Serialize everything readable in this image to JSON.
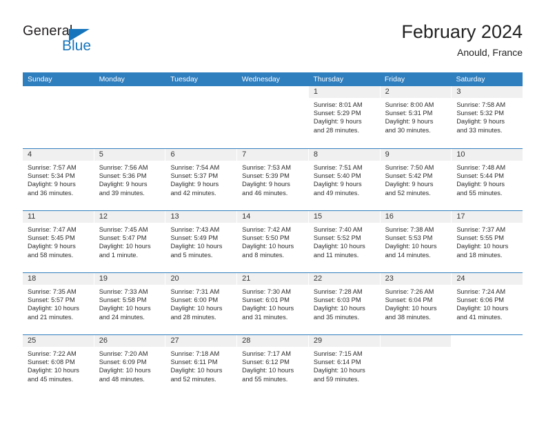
{
  "brand": {
    "name_top": "General",
    "name_bottom": "Blue",
    "accent_color": "#1574bb"
  },
  "header": {
    "title": "February 2024",
    "subtitle": "Anould, France"
  },
  "calendar": {
    "header_bg": "#2f7ebe",
    "header_text_color": "#ffffff",
    "daynum_bg": "#f0f0f0",
    "weekdays": [
      "Sunday",
      "Monday",
      "Tuesday",
      "Wednesday",
      "Thursday",
      "Friday",
      "Saturday"
    ],
    "labels": {
      "sunrise": "Sunrise:",
      "sunset": "Sunset:",
      "daylight": "Daylight:"
    },
    "weeks": [
      [
        {
          "day": "",
          "sunrise": "",
          "sunset": "",
          "daylight_line1": "",
          "daylight_line2": "",
          "filled": false
        },
        {
          "day": "",
          "sunrise": "",
          "sunset": "",
          "daylight_line1": "",
          "daylight_line2": "",
          "filled": false
        },
        {
          "day": "",
          "sunrise": "",
          "sunset": "",
          "daylight_line1": "",
          "daylight_line2": "",
          "filled": false
        },
        {
          "day": "",
          "sunrise": "",
          "sunset": "",
          "daylight_line1": "",
          "daylight_line2": "",
          "filled": false
        },
        {
          "day": "1",
          "sunrise": "Sunrise: 8:01 AM",
          "sunset": "Sunset: 5:29 PM",
          "daylight_line1": "Daylight: 9 hours",
          "daylight_line2": "and 28 minutes.",
          "filled": true
        },
        {
          "day": "2",
          "sunrise": "Sunrise: 8:00 AM",
          "sunset": "Sunset: 5:31 PM",
          "daylight_line1": "Daylight: 9 hours",
          "daylight_line2": "and 30 minutes.",
          "filled": true
        },
        {
          "day": "3",
          "sunrise": "Sunrise: 7:58 AM",
          "sunset": "Sunset: 5:32 PM",
          "daylight_line1": "Daylight: 9 hours",
          "daylight_line2": "and 33 minutes.",
          "filled": true
        }
      ],
      [
        {
          "day": "4",
          "sunrise": "Sunrise: 7:57 AM",
          "sunset": "Sunset: 5:34 PM",
          "daylight_line1": "Daylight: 9 hours",
          "daylight_line2": "and 36 minutes.",
          "filled": true
        },
        {
          "day": "5",
          "sunrise": "Sunrise: 7:56 AM",
          "sunset": "Sunset: 5:36 PM",
          "daylight_line1": "Daylight: 9 hours",
          "daylight_line2": "and 39 minutes.",
          "filled": true
        },
        {
          "day": "6",
          "sunrise": "Sunrise: 7:54 AM",
          "sunset": "Sunset: 5:37 PM",
          "daylight_line1": "Daylight: 9 hours",
          "daylight_line2": "and 42 minutes.",
          "filled": true
        },
        {
          "day": "7",
          "sunrise": "Sunrise: 7:53 AM",
          "sunset": "Sunset: 5:39 PM",
          "daylight_line1": "Daylight: 9 hours",
          "daylight_line2": "and 46 minutes.",
          "filled": true
        },
        {
          "day": "8",
          "sunrise": "Sunrise: 7:51 AM",
          "sunset": "Sunset: 5:40 PM",
          "daylight_line1": "Daylight: 9 hours",
          "daylight_line2": "and 49 minutes.",
          "filled": true
        },
        {
          "day": "9",
          "sunrise": "Sunrise: 7:50 AM",
          "sunset": "Sunset: 5:42 PM",
          "daylight_line1": "Daylight: 9 hours",
          "daylight_line2": "and 52 minutes.",
          "filled": true
        },
        {
          "day": "10",
          "sunrise": "Sunrise: 7:48 AM",
          "sunset": "Sunset: 5:44 PM",
          "daylight_line1": "Daylight: 9 hours",
          "daylight_line2": "and 55 minutes.",
          "filled": true
        }
      ],
      [
        {
          "day": "11",
          "sunrise": "Sunrise: 7:47 AM",
          "sunset": "Sunset: 5:45 PM",
          "daylight_line1": "Daylight: 9 hours",
          "daylight_line2": "and 58 minutes.",
          "filled": true
        },
        {
          "day": "12",
          "sunrise": "Sunrise: 7:45 AM",
          "sunset": "Sunset: 5:47 PM",
          "daylight_line1": "Daylight: 10 hours",
          "daylight_line2": "and 1 minute.",
          "filled": true
        },
        {
          "day": "13",
          "sunrise": "Sunrise: 7:43 AM",
          "sunset": "Sunset: 5:49 PM",
          "daylight_line1": "Daylight: 10 hours",
          "daylight_line2": "and 5 minutes.",
          "filled": true
        },
        {
          "day": "14",
          "sunrise": "Sunrise: 7:42 AM",
          "sunset": "Sunset: 5:50 PM",
          "daylight_line1": "Daylight: 10 hours",
          "daylight_line2": "and 8 minutes.",
          "filled": true
        },
        {
          "day": "15",
          "sunrise": "Sunrise: 7:40 AM",
          "sunset": "Sunset: 5:52 PM",
          "daylight_line1": "Daylight: 10 hours",
          "daylight_line2": "and 11 minutes.",
          "filled": true
        },
        {
          "day": "16",
          "sunrise": "Sunrise: 7:38 AM",
          "sunset": "Sunset: 5:53 PM",
          "daylight_line1": "Daylight: 10 hours",
          "daylight_line2": "and 14 minutes.",
          "filled": true
        },
        {
          "day": "17",
          "sunrise": "Sunrise: 7:37 AM",
          "sunset": "Sunset: 5:55 PM",
          "daylight_line1": "Daylight: 10 hours",
          "daylight_line2": "and 18 minutes.",
          "filled": true
        }
      ],
      [
        {
          "day": "18",
          "sunrise": "Sunrise: 7:35 AM",
          "sunset": "Sunset: 5:57 PM",
          "daylight_line1": "Daylight: 10 hours",
          "daylight_line2": "and 21 minutes.",
          "filled": true
        },
        {
          "day": "19",
          "sunrise": "Sunrise: 7:33 AM",
          "sunset": "Sunset: 5:58 PM",
          "daylight_line1": "Daylight: 10 hours",
          "daylight_line2": "and 24 minutes.",
          "filled": true
        },
        {
          "day": "20",
          "sunrise": "Sunrise: 7:31 AM",
          "sunset": "Sunset: 6:00 PM",
          "daylight_line1": "Daylight: 10 hours",
          "daylight_line2": "and 28 minutes.",
          "filled": true
        },
        {
          "day": "21",
          "sunrise": "Sunrise: 7:30 AM",
          "sunset": "Sunset: 6:01 PM",
          "daylight_line1": "Daylight: 10 hours",
          "daylight_line2": "and 31 minutes.",
          "filled": true
        },
        {
          "day": "22",
          "sunrise": "Sunrise: 7:28 AM",
          "sunset": "Sunset: 6:03 PM",
          "daylight_line1": "Daylight: 10 hours",
          "daylight_line2": "and 35 minutes.",
          "filled": true
        },
        {
          "day": "23",
          "sunrise": "Sunrise: 7:26 AM",
          "sunset": "Sunset: 6:04 PM",
          "daylight_line1": "Daylight: 10 hours",
          "daylight_line2": "and 38 minutes.",
          "filled": true
        },
        {
          "day": "24",
          "sunrise": "Sunrise: 7:24 AM",
          "sunset": "Sunset: 6:06 PM",
          "daylight_line1": "Daylight: 10 hours",
          "daylight_line2": "and 41 minutes.",
          "filled": true
        }
      ],
      [
        {
          "day": "25",
          "sunrise": "Sunrise: 7:22 AM",
          "sunset": "Sunset: 6:08 PM",
          "daylight_line1": "Daylight: 10 hours",
          "daylight_line2": "and 45 minutes.",
          "filled": true
        },
        {
          "day": "26",
          "sunrise": "Sunrise: 7:20 AM",
          "sunset": "Sunset: 6:09 PM",
          "daylight_line1": "Daylight: 10 hours",
          "daylight_line2": "and 48 minutes.",
          "filled": true
        },
        {
          "day": "27",
          "sunrise": "Sunrise: 7:18 AM",
          "sunset": "Sunset: 6:11 PM",
          "daylight_line1": "Daylight: 10 hours",
          "daylight_line2": "and 52 minutes.",
          "filled": true
        },
        {
          "day": "28",
          "sunrise": "Sunrise: 7:17 AM",
          "sunset": "Sunset: 6:12 PM",
          "daylight_line1": "Daylight: 10 hours",
          "daylight_line2": "and 55 minutes.",
          "filled": true
        },
        {
          "day": "29",
          "sunrise": "Sunrise: 7:15 AM",
          "sunset": "Sunset: 6:14 PM",
          "daylight_line1": "Daylight: 10 hours",
          "daylight_line2": "and 59 minutes.",
          "filled": true
        },
        {
          "day": "",
          "sunrise": "",
          "sunset": "",
          "daylight_line1": "",
          "daylight_line2": "",
          "filled": true
        },
        {
          "day": "",
          "sunrise": "",
          "sunset": "",
          "daylight_line1": "",
          "daylight_line2": "",
          "filled": false
        }
      ]
    ]
  }
}
